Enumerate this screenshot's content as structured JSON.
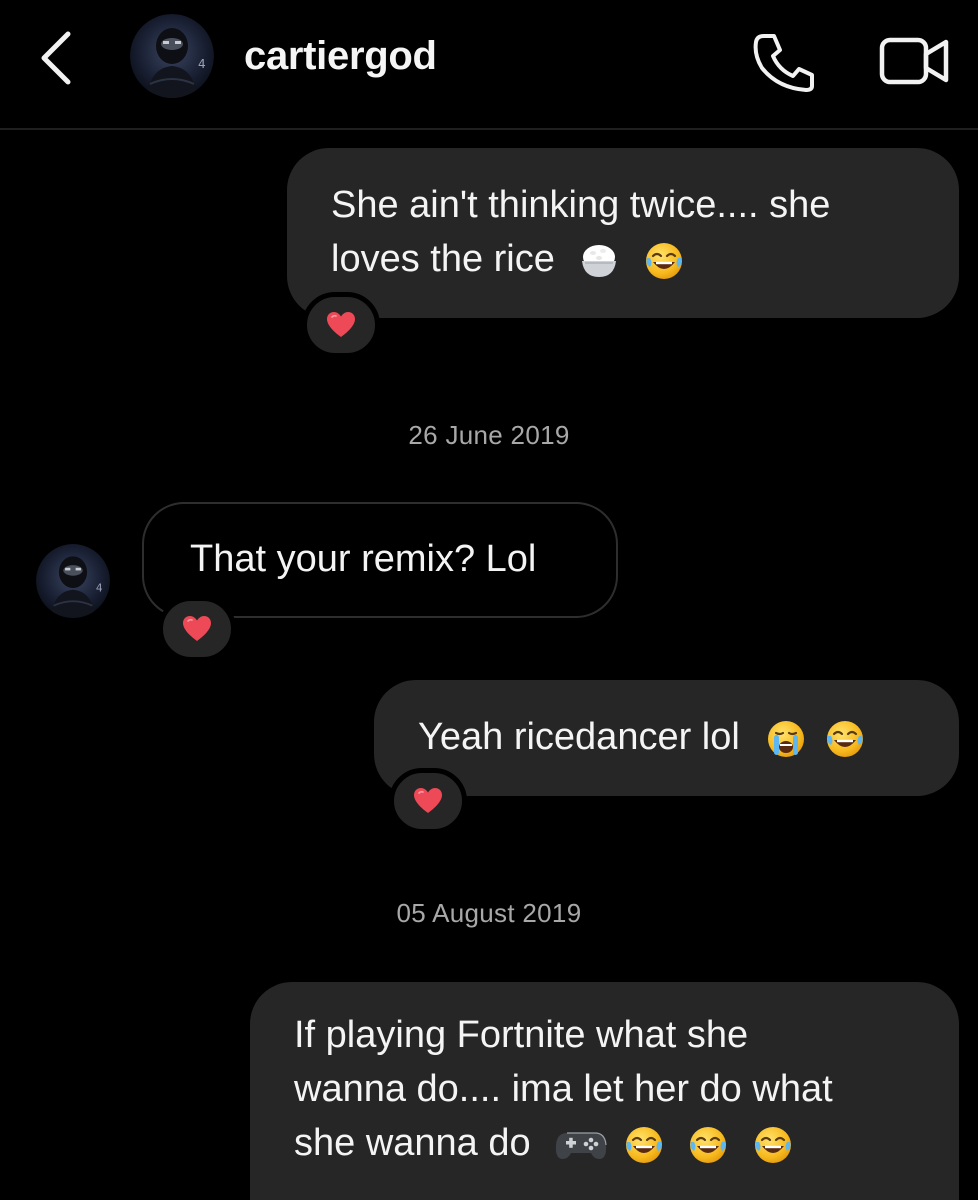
{
  "header": {
    "username": "cartiergod",
    "back_icon": "chevron-left-icon",
    "call_icon": "phone-icon",
    "video_icon": "video-camera-icon"
  },
  "messages": [
    {
      "direction": "out",
      "lines": [
        "She ain't thinking twice.... she",
        "loves the rice"
      ],
      "emojis": [
        "rice-bowl",
        "tears-of-joy"
      ],
      "reaction": "heart"
    },
    {
      "direction": "in",
      "lines": [
        "That your remix? Lol"
      ],
      "reaction": "heart"
    },
    {
      "direction": "out",
      "lines": [
        "Yeah ricedancer lol"
      ],
      "emojis": [
        "crying",
        "tears-of-joy"
      ],
      "reaction": "heart"
    },
    {
      "direction": "out",
      "lines": [
        "If playing Fortnite what she",
        "wanna do.... ima let her do what",
        "she wanna do"
      ],
      "emojis": [
        "video-game",
        "tears-of-joy",
        "tears-of-joy",
        "tears-of-joy"
      ]
    }
  ],
  "dates": [
    "26 June 2019",
    "05 August 2019"
  ],
  "colors": {
    "background": "#000000",
    "bubble_out": "#262626",
    "bubble_in_border": "#2e2e2e",
    "text": "#f4f4f4",
    "date_text": "#a8a8a8",
    "heart": "#ed4956"
  }
}
